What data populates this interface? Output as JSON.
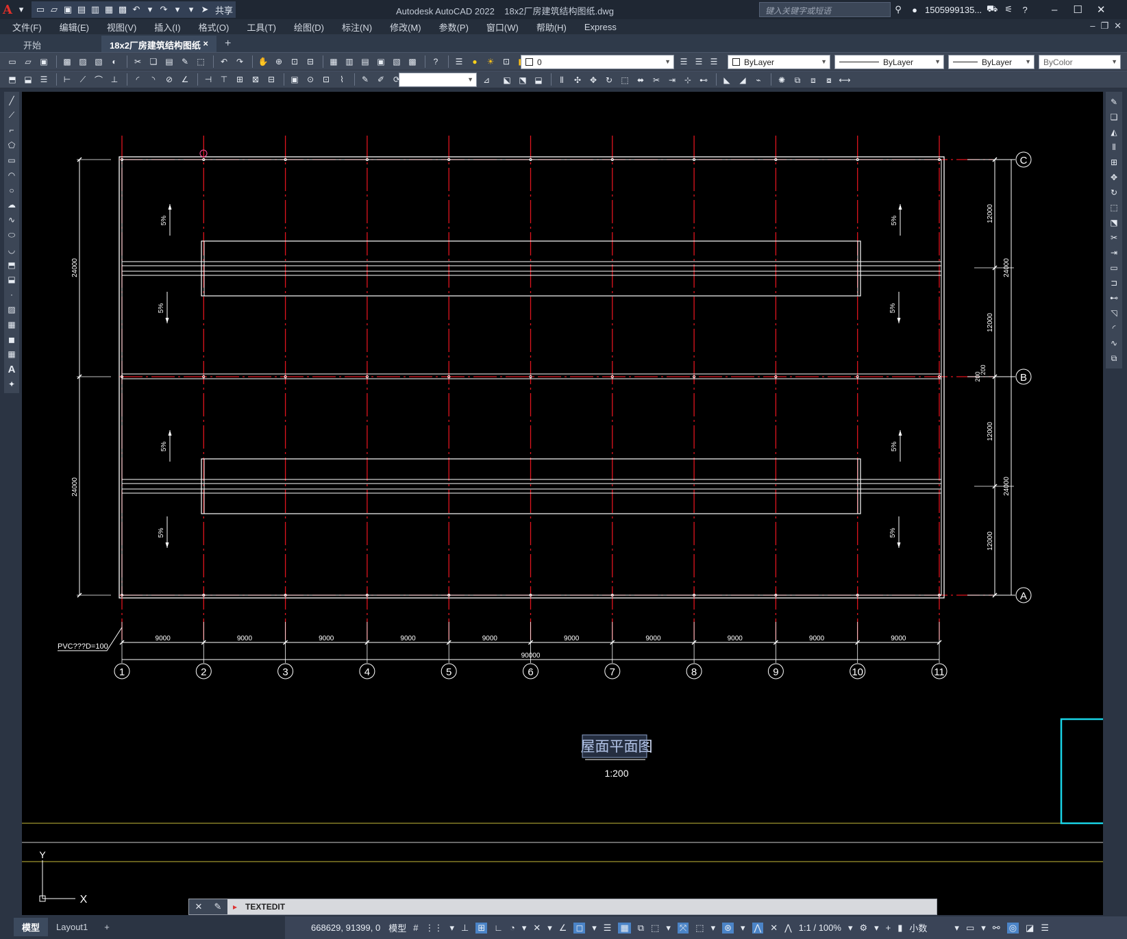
{
  "window": {
    "app_title": "Autodesk AutoCAD 2022",
    "file_title": "18x2厂房建筑结构图纸.dwg",
    "search_placeholder": "键入关键字或短语",
    "user": "1505999135...",
    "share_label": "共享"
  },
  "menu": [
    "文件(F)",
    "编辑(E)",
    "视图(V)",
    "插入(I)",
    "格式(O)",
    "工具(T)",
    "绘图(D)",
    "标注(N)",
    "修改(M)",
    "参数(P)",
    "窗口(W)",
    "帮助(H)",
    "Express"
  ],
  "tabs": {
    "start": "开始",
    "document": "18x2厂房建筑结构图纸*",
    "close": "×",
    "add": "+"
  },
  "properties": {
    "layer": "0",
    "color": "ByLayer",
    "linetype": "ByLayer",
    "lineweight": "ByLayer",
    "plotstyle": "ByColor"
  },
  "drawing": {
    "title": "屋面平面图",
    "scale": "1:200",
    "pvc_note": "PVC???D=100",
    "slope": "5%",
    "bay_dimension": "9000",
    "total_length": "90000",
    "span": "24000",
    "half_span": "12000",
    "ridge_dim": "200",
    "ucs_y": "Y",
    "ucs_x": "X",
    "axis_numbers": [
      "1",
      "2",
      "3",
      "4",
      "5",
      "6",
      "7",
      "8",
      "9",
      "10",
      "11"
    ],
    "axis_letters": [
      "C",
      "B",
      "A"
    ]
  },
  "command": {
    "text": "TEXTEDIT"
  },
  "status": {
    "layout_tabs": [
      "模型",
      "Layout1",
      "+"
    ],
    "coordinates": "668629, 91399, 0",
    "space": "模型",
    "scale": "1:1 / 100%",
    "units": "小数"
  },
  "colors": {
    "axis_red": "#e0141e",
    "outline_white": "#ffffff",
    "highlight_cyan": "#19d4e6",
    "line_yellow": "#c8bd3a"
  }
}
